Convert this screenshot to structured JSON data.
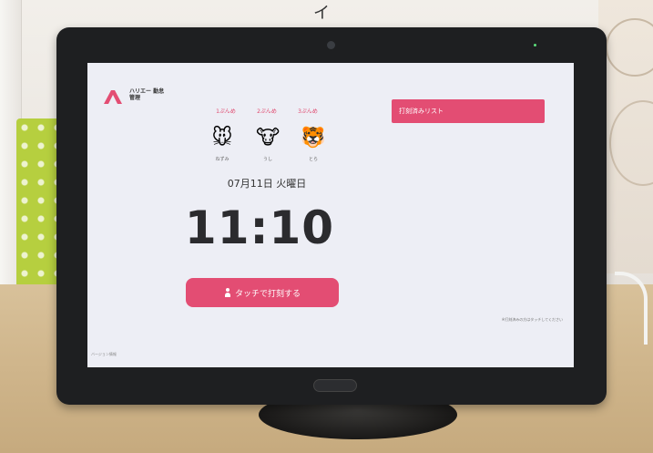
{
  "colors": {
    "brand": "#e34d73",
    "screen_bg": "#edeef5"
  },
  "wall_mark": "イ",
  "app": {
    "logo_icon": "letter-a-logo",
    "logo_text": "ハリエー 勤怠管理",
    "animals": [
      {
        "label": "1ぷんめ",
        "icon": "mouse",
        "glyph": "🐭",
        "name": "ねずみ"
      },
      {
        "label": "2ぷんめ",
        "icon": "cow",
        "glyph": "🐮",
        "name": "うし"
      },
      {
        "label": "3ぷんめ",
        "icon": "tiger",
        "glyph": "🐯",
        "name": "とら"
      }
    ],
    "date": "07月11日 火曜日",
    "time": "11:10",
    "touch_button_label": "タッチで打刻する",
    "touch_icon": "person-icon",
    "list_header": "打刻済みリスト",
    "note_right": "※打刻済みの方はタッチしてください",
    "note_bottom": "バージョン情報"
  }
}
